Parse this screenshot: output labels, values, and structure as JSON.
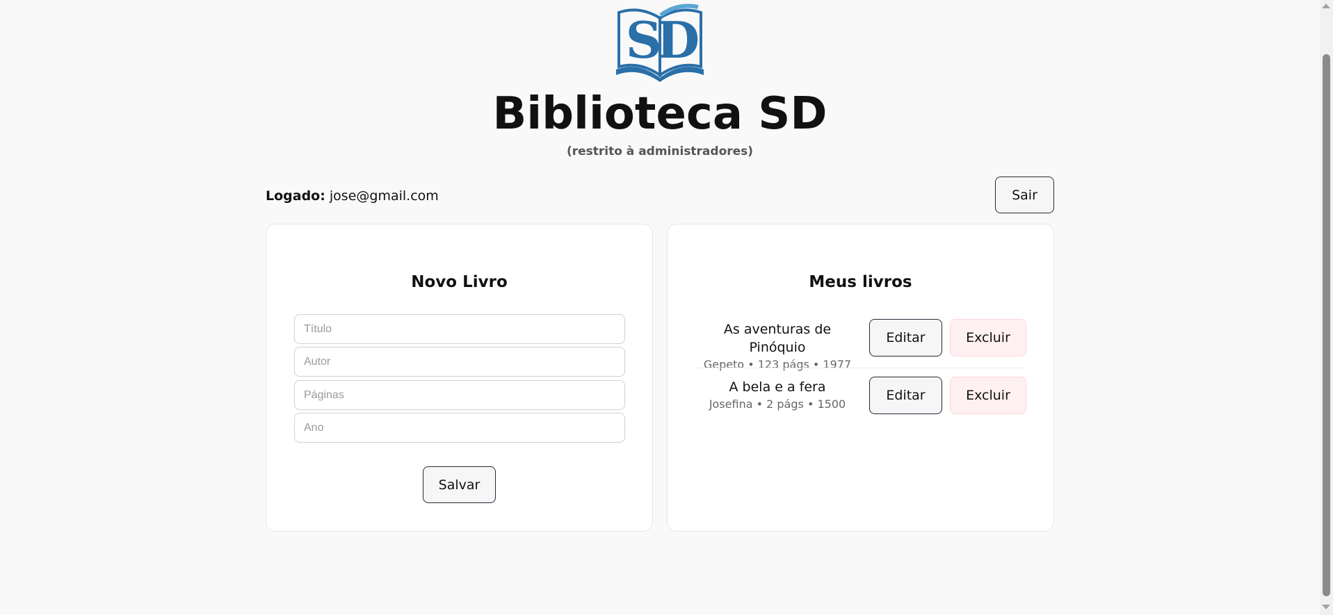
{
  "brand": {
    "logo_text": "SD",
    "title": "Biblioteca SD",
    "subtitle": "(restrito à administradores)",
    "colors": {
      "logo_blue": "#2a6fa8",
      "logo_light": "#5aa6d6"
    }
  },
  "session": {
    "label": "Logado:",
    "email": "jose@gmail.com",
    "logout_label": "Sair"
  },
  "new_book": {
    "title": "Novo Livro",
    "fields": {
      "titulo_placeholder": "Título",
      "autor_placeholder": "Autor",
      "paginas_placeholder": "Páginas",
      "ano_placeholder": "Ano"
    },
    "save_label": "Salvar"
  },
  "my_books": {
    "title": "Meus livros",
    "edit_label": "Editar",
    "delete_label": "Excluir",
    "delete_color": "#fff0f1",
    "items": [
      {
        "title": "As aventuras de Pinóquio",
        "meta": "Gepeto • 123 págs • 1977"
      },
      {
        "title": "A bela e a fera",
        "meta": "Josefina • 2 págs • 1500"
      }
    ]
  }
}
